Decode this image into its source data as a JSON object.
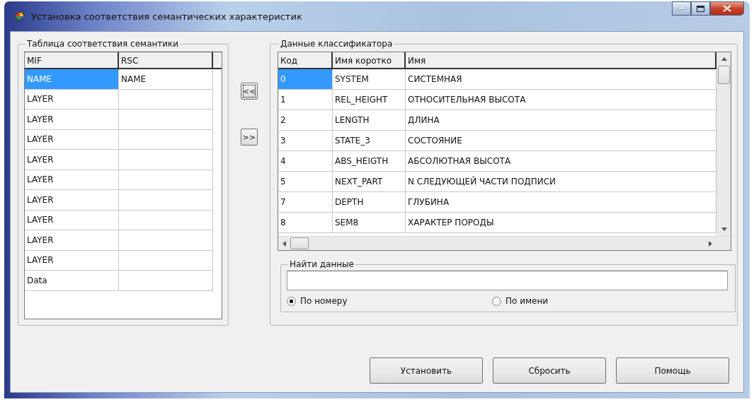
{
  "window": {
    "title": "Установка соответствия семантических характеристик"
  },
  "mapping_group": {
    "title": "Таблица соответствия семантики",
    "columns": [
      "MIF",
      "RSC"
    ],
    "rows": [
      {
        "cells": [
          "NAME",
          "NAME"
        ],
        "selected": true
      },
      {
        "cells": [
          "LAYER",
          ""
        ],
        "selected": false
      },
      {
        "cells": [
          "LAYER",
          ""
        ],
        "selected": false
      },
      {
        "cells": [
          "LAYER",
          ""
        ],
        "selected": false
      },
      {
        "cells": [
          "LAYER",
          ""
        ],
        "selected": false
      },
      {
        "cells": [
          "LAYER",
          ""
        ],
        "selected": false
      },
      {
        "cells": [
          "LAYER",
          ""
        ],
        "selected": false
      },
      {
        "cells": [
          "LAYER",
          ""
        ],
        "selected": false
      },
      {
        "cells": [
          "LAYER",
          ""
        ],
        "selected": false
      },
      {
        "cells": [
          "LAYER",
          ""
        ],
        "selected": false
      },
      {
        "cells": [
          "Data",
          ""
        ],
        "selected": false
      }
    ]
  },
  "transfer_buttons": [
    {
      "label": "<<",
      "focused": true
    },
    {
      "label": ">>",
      "focused": false
    }
  ],
  "classifier_group": {
    "title": "Данные классификатора",
    "columns": [
      "Код",
      "Имя коротко",
      "Имя"
    ],
    "rows": [
      {
        "cells": [
          "0",
          "SYSTEM",
          "СИСТЕМНАЯ"
        ],
        "selected": true
      },
      {
        "cells": [
          "1",
          "REL_HEIGHT",
          "ОТНОСИТЕЛЬНАЯ ВЫСОТА"
        ],
        "selected": false
      },
      {
        "cells": [
          "2",
          "LENGTH",
          "ДЛИНА"
        ],
        "selected": false
      },
      {
        "cells": [
          "3",
          "STATE_3",
          "СОСТОЯНИЕ"
        ],
        "selected": false
      },
      {
        "cells": [
          "4",
          "ABS_HEIGTH",
          "АБСОЛЮТНАЯ ВЫСОТА"
        ],
        "selected": false
      },
      {
        "cells": [
          "5",
          "NEXT_PART",
          "N СЛЕДУЮЩЕЙ ЧАСТИ ПОДПИСИ"
        ],
        "selected": false
      },
      {
        "cells": [
          "7",
          "DEPTH",
          "ГЛУБИНА"
        ],
        "selected": false
      },
      {
        "cells": [
          "8",
          "SEM8",
          "ХАРАКТЕР ПОРОДЫ"
        ],
        "selected": false
      }
    ]
  },
  "search_group": {
    "title": "Найти данные",
    "options": [
      {
        "label": "По номеру",
        "selected": true
      },
      {
        "label": "По имени",
        "selected": false
      }
    ]
  },
  "buttons": [
    "Установить",
    "Сбросить",
    "Помощь"
  ]
}
